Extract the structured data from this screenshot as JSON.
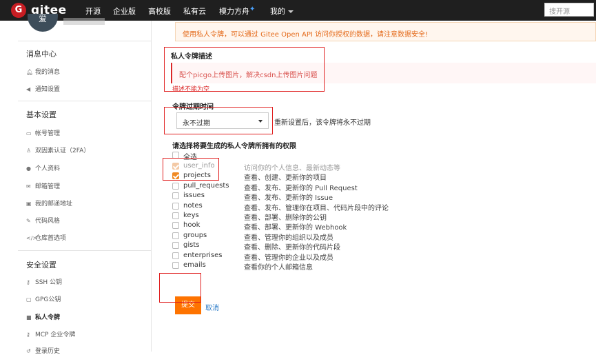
{
  "topbar": {
    "logo_letter": "G",
    "logo_text": "gitee",
    "nav": [
      "开源",
      "企业版",
      "高校版",
      "私有云",
      "模力方舟"
    ],
    "my_label": "我的",
    "search_placeholder": "搜开源"
  },
  "sidebar": {
    "avatar_letter": "爱",
    "sections": [
      {
        "title": "消息中心",
        "items": [
          {
            "icon": "bell-icon",
            "label": "我的消息"
          },
          {
            "icon": "volume-icon",
            "label": "通知设置"
          }
        ]
      },
      {
        "title": "基本设置",
        "items": [
          {
            "icon": "id-card-icon",
            "label": "帐号管理"
          },
          {
            "icon": "two-factor-icon",
            "label": "双因素认证（2FA）"
          },
          {
            "icon": "user-icon",
            "label": "个人资料"
          },
          {
            "icon": "mail-icon",
            "label": "邮箱管理"
          },
          {
            "icon": "address-icon",
            "label": "我的邮递地址"
          },
          {
            "icon": "brush-icon",
            "label": "代码风格"
          },
          {
            "icon": "code-icon",
            "label": "仓库首选项"
          }
        ]
      },
      {
        "title": "安全设置",
        "items": [
          {
            "icon": "key-icon",
            "label": "SSH 公钥"
          },
          {
            "icon": "lock-icon",
            "label": "GPG公钥"
          },
          {
            "icon": "lock-icon",
            "label": "私人令牌"
          },
          {
            "icon": "key-icon",
            "label": "MCP 企业令牌"
          },
          {
            "icon": "history-icon",
            "label": "登录历史"
          }
        ]
      }
    ]
  },
  "main": {
    "alert": "使用私人令牌，可以通过 Gitee Open API 访问你授权的数据，请注意数据安全!",
    "desc_label": "私人令牌描述",
    "desc_value": "配个picgo上传图片，解决csdn上传图片问题",
    "desc_error": "描述不能为空",
    "expiry_label": "令牌过期时间",
    "expiry_value": "永不过期",
    "expiry_hint": "重新设置后，该令牌将永不过期",
    "perm_label": "请选择将要生成的私人令牌所拥有的权限",
    "select_all": "全选",
    "permissions": [
      {
        "name": "user_info",
        "desc": "访问你的个人信息、最新动态等",
        "checked": true,
        "disabled": true
      },
      {
        "name": "projects",
        "desc": "查看、创建、更新你的项目",
        "checked": true,
        "disabled": false
      },
      {
        "name": "pull_requests",
        "desc": "查看、发布、更新你的 Pull Request",
        "checked": false,
        "disabled": false
      },
      {
        "name": "issues",
        "desc": "查看、发布、更新你的 Issue",
        "checked": false,
        "disabled": false
      },
      {
        "name": "notes",
        "desc": "查看、发布、管理你在项目、代码片段中的评论",
        "checked": false,
        "disabled": false
      },
      {
        "name": "keys",
        "desc": "查看、部署、删除你的公钥",
        "checked": false,
        "disabled": false
      },
      {
        "name": "hook",
        "desc": "查看、部署、更新你的 Webhook",
        "checked": false,
        "disabled": false
      },
      {
        "name": "groups",
        "desc": "查看、管理你的组织以及成员",
        "checked": false,
        "disabled": false
      },
      {
        "name": "gists",
        "desc": "查看、删除、更新你的代码片段",
        "checked": false,
        "disabled": false
      },
      {
        "name": "enterprises",
        "desc": "查看、管理你的企业以及成员",
        "checked": false,
        "disabled": false
      },
      {
        "name": "emails",
        "desc": "查看你的个人邮箱信息",
        "checked": false,
        "disabled": false
      }
    ],
    "submit_label": "提交",
    "cancel_label": "取消"
  }
}
